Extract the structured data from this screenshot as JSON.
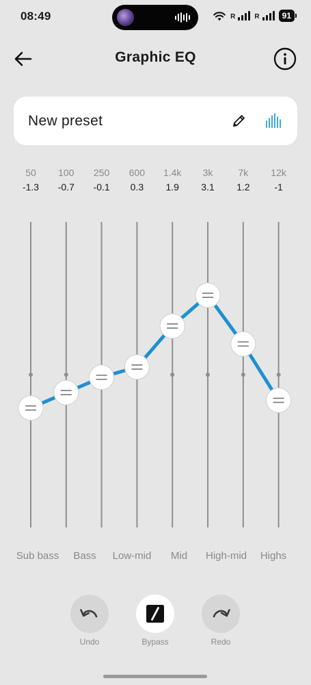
{
  "status_bar": {
    "time": "08:49",
    "carrier1": "R",
    "carrier2": "R",
    "battery": "91"
  },
  "header": {
    "title": "Graphic EQ",
    "back_icon": "arrow-left-icon",
    "info_icon": "info-circle-icon"
  },
  "preset": {
    "name": "New preset",
    "edit_icon": "pencil-icon",
    "eq_icon": "equalizer-bars-icon",
    "accent_color": "#2a9fd6"
  },
  "bands": [
    {
      "freq": "50",
      "gain": "-1.3",
      "value": -1.3
    },
    {
      "freq": "100",
      "gain": "-0.7",
      "value": -0.7
    },
    {
      "freq": "250",
      "gain": "-0.1",
      "value": -0.1
    },
    {
      "freq": "600",
      "gain": "0.3",
      "value": 0.3
    },
    {
      "freq": "1.4k",
      "gain": "1.9",
      "value": 1.9
    },
    {
      "freq": "3k",
      "gain": "3.1",
      "value": 3.1
    },
    {
      "freq": "7k",
      "gain": "1.2",
      "value": 1.2
    },
    {
      "freq": "12k",
      "gain": "-1",
      "value": -1
    }
  ],
  "regions": [
    "Sub bass",
    "Bass",
    "Low-mid",
    "Mid",
    "High-mid",
    "Highs"
  ],
  "controls": {
    "undo": "Undo",
    "bypass": "Bypass",
    "redo": "Redo"
  },
  "colors": {
    "curve": "#1e90d2",
    "background": "#e6e6e6",
    "card": "#ffffff"
  }
}
